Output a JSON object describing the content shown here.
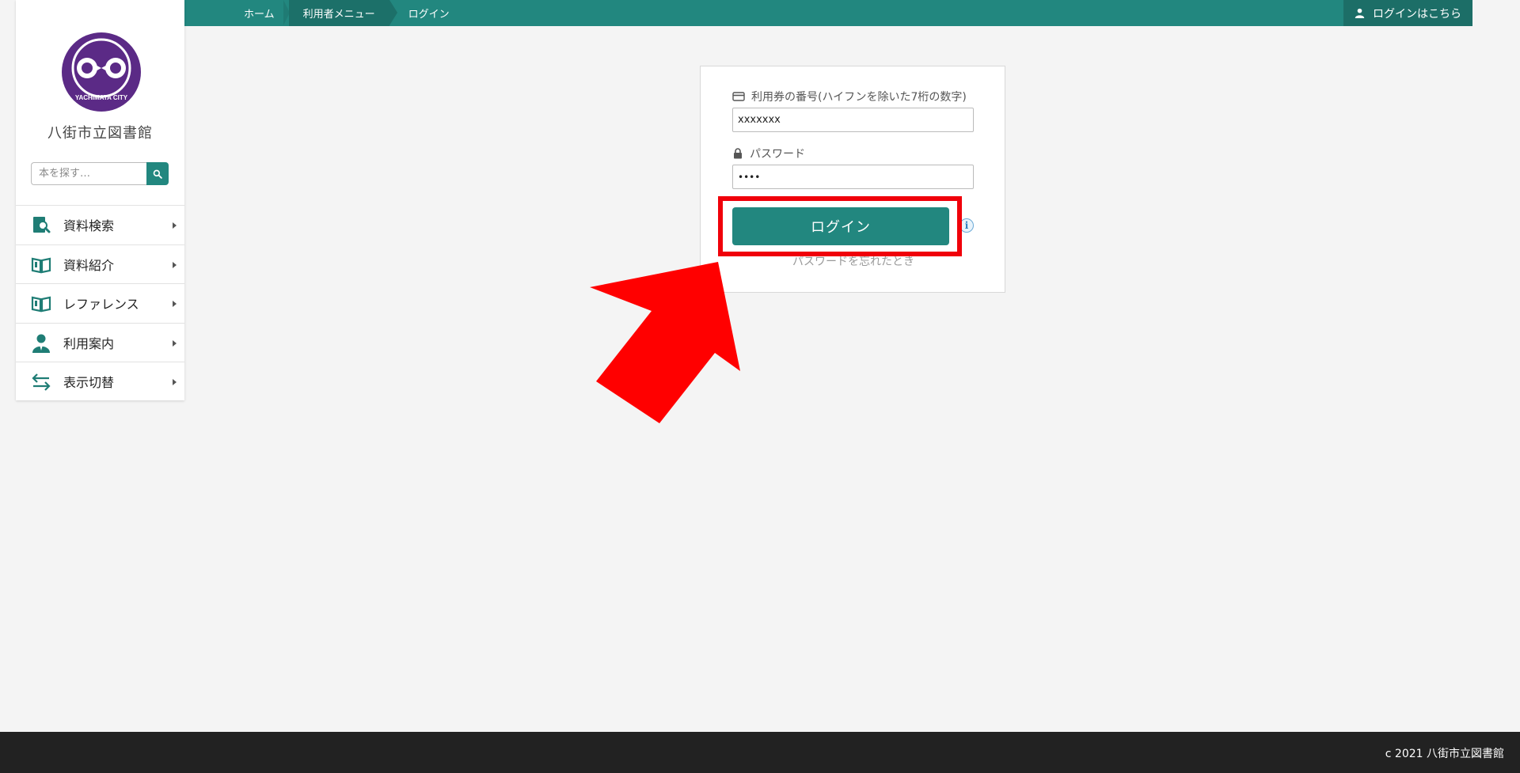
{
  "header": {
    "breadcrumb": [
      "ホーム",
      "利用者メニュー",
      "ログイン"
    ],
    "login_link": "ログインはこちら"
  },
  "sidebar": {
    "logo_text": "YACHIMATA CITY",
    "library_name": "八街市立図書館",
    "search_placeholder": "本を探す…",
    "menu": [
      {
        "label": "資料検索",
        "icon": "document-search-icon"
      },
      {
        "label": "資料紹介",
        "icon": "open-book-icon"
      },
      {
        "label": "レファレンス",
        "icon": "open-book-icon"
      },
      {
        "label": "利用案内",
        "icon": "person-icon"
      },
      {
        "label": "表示切替",
        "icon": "swap-arrows-icon"
      }
    ]
  },
  "login_form": {
    "card_label": "利用券の番号(ハイフンを除いた7桁の数字)",
    "card_value": "xxxxxxx",
    "password_label": "パスワード",
    "password_value": "••••",
    "login_button": "ログイン",
    "forgot_link": "パスワードを忘れたとき"
  },
  "footer": {
    "copyright": "c 2021 八街市立図書館"
  },
  "colors": {
    "teal": "#22877f",
    "annotation_red": "#f0000a",
    "logo_purple": "#5b2a86"
  }
}
